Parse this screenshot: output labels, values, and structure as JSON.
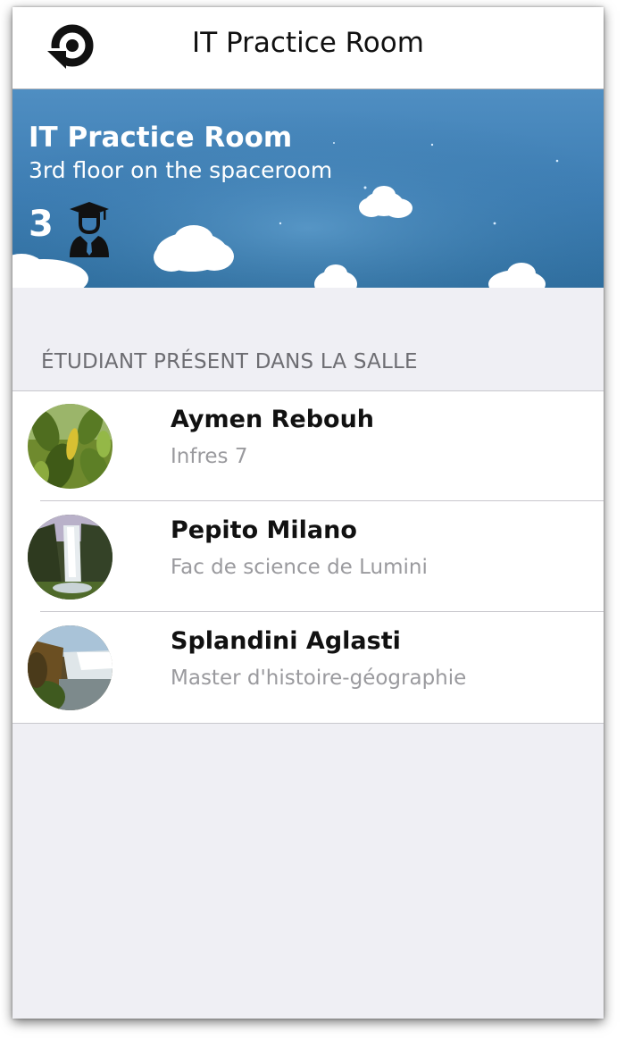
{
  "navbar": {
    "title": "IT Practice Room",
    "back_icon": "refresh-back-icon"
  },
  "room": {
    "name": "IT Practice Room",
    "location": "3rd floor on the spaceroom",
    "student_count": "3",
    "count_icon": "graduate-icon"
  },
  "section": {
    "header": "ÉTUDIANT PRÉSENT DANS LA SALLE"
  },
  "students": [
    {
      "name": "Aymen Rebouh",
      "program": "Infres 7",
      "avatar": "leaves-photo"
    },
    {
      "name": "Pepito Milano",
      "program": "Fac de science de Lumini",
      "avatar": "waterfall-photo"
    },
    {
      "name": "Splandini Aglasti",
      "program": "Master d'histoire-géographie",
      "avatar": "waterfall-photo"
    }
  ],
  "colors": {
    "banner_top": "#4f8ec2",
    "banner_bottom": "#2f6e9e",
    "background": "#efeff4",
    "subtitle_gray": "#9a9a9e",
    "section_gray": "#6d6d72"
  }
}
